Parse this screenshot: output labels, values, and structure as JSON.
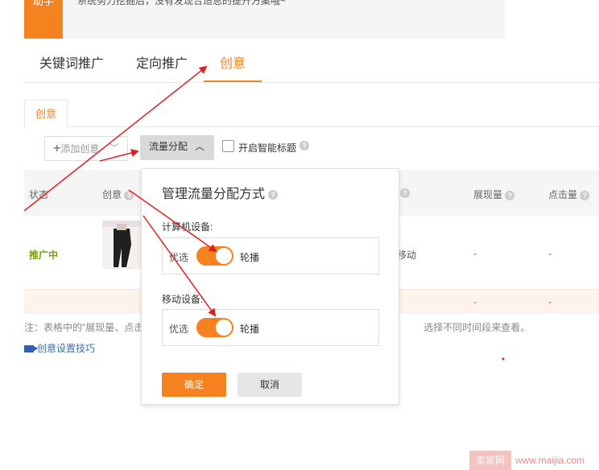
{
  "tip": {
    "badge": "助手",
    "text": "系统努力挖掘后，没有发现合适总的提升方案哦~"
  },
  "main_tabs": [
    {
      "label": "关键词推广"
    },
    {
      "label": "定向推广"
    },
    {
      "label": "创意",
      "active": true
    }
  ],
  "sub_tab": "创意",
  "toolbar": {
    "add_label": "添加创意",
    "flow_label": "流量分配",
    "smart_title_label": "开启智能标题"
  },
  "table": {
    "headers": [
      "状态",
      "创意",
      "展现量",
      "点击量"
    ],
    "rows": [
      {
        "status": "推广中",
        "device": "移动",
        "impressions": "-",
        "clicks": "-"
      },
      {
        "impressions": "-",
        "clicks": "-"
      }
    ]
  },
  "note_left": "注：表格中的\"展现量、点击",
  "note_right": "选择不同时间段来查看。",
  "tips_link": "创意设置技巧",
  "popup": {
    "title": "管理流量分配方式",
    "devices": [
      {
        "label": "计算机设备:",
        "left_option": "优选",
        "right_option": "轮播",
        "selected": "轮播"
      },
      {
        "label": "移动设备:",
        "left_option": "优选",
        "right_option": "轮播",
        "selected": "轮播"
      }
    ],
    "ok_label": "确定",
    "cancel_label": "取消"
  },
  "watermark": {
    "logo": "卖家网",
    "url": "www.maijia.com"
  },
  "colors": {
    "accent": "#f5821f",
    "status_green": "#71a400",
    "link_blue": "#3a6fb0",
    "annotation_red": "#e02020"
  }
}
